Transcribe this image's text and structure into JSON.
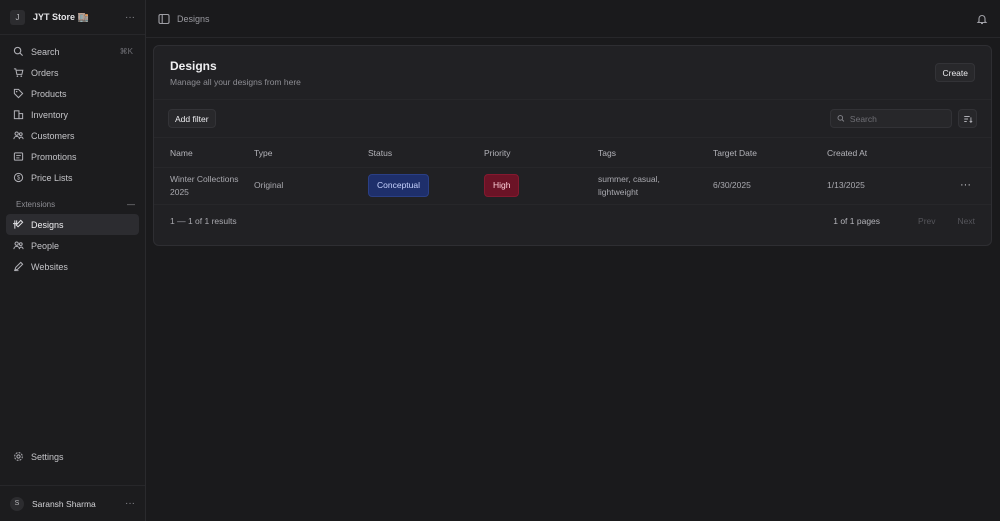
{
  "sidebar": {
    "store_initial": "J",
    "store_name": "JYT Store 🏬",
    "menu_dots": "···",
    "nav": [
      {
        "label": "Search",
        "shortcut": "⌘K"
      },
      {
        "label": "Orders"
      },
      {
        "label": "Products"
      },
      {
        "label": "Inventory"
      },
      {
        "label": "Customers"
      },
      {
        "label": "Promotions"
      },
      {
        "label": "Price Lists"
      }
    ],
    "extensions_label": "Extensions",
    "extensions_toggle": "—",
    "extensions": [
      {
        "label": "Designs",
        "active": true
      },
      {
        "label": "People"
      },
      {
        "label": "Websites"
      }
    ],
    "settings_label": "Settings",
    "user_initial": "S",
    "user_name": "Saransh Sharma",
    "user_dots": "···"
  },
  "topbar": {
    "breadcrumb": "Designs"
  },
  "page": {
    "title": "Designs",
    "subtitle": "Manage all your designs from here",
    "create_label": "Create",
    "add_filter_label": "Add filter",
    "search_placeholder": "Search"
  },
  "table": {
    "columns": {
      "name": "Name",
      "type": "Type",
      "status": "Status",
      "priority": "Priority",
      "tags": "Tags",
      "target_date": "Target Date",
      "created_at": "Created At"
    },
    "rows": [
      {
        "name_line1": "Winter Collections",
        "name_line2": "2025",
        "type": "Original",
        "status": "Conceptual",
        "priority": "High",
        "tags_line1": "summer, casual,",
        "tags_line2": "lightweight",
        "target_date": "6/30/2025",
        "created_at": "1/13/2025",
        "actions": "···"
      }
    ]
  },
  "footer": {
    "results": "1 — 1 of 1 results",
    "pages": "1 of 1 pages",
    "prev": "Prev",
    "next": "Next"
  },
  "colors": {
    "status_conceptual": "#1e2f6b",
    "priority_high": "#6b1326",
    "background": "#1a1a1c"
  }
}
